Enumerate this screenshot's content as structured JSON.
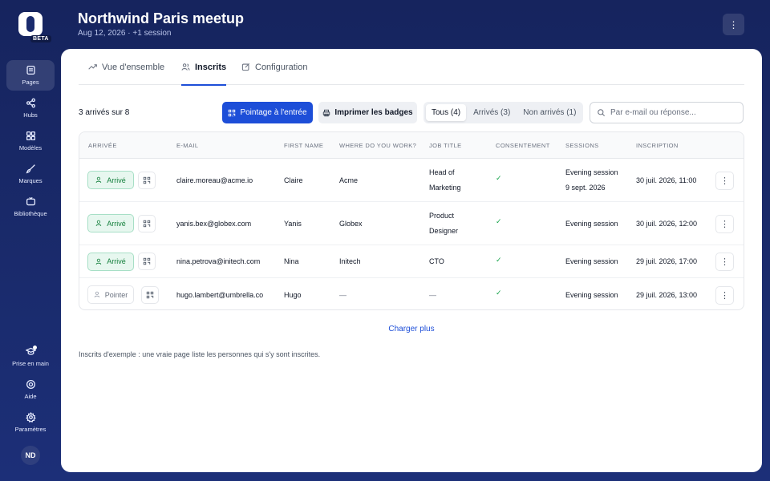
{
  "app": {
    "beta_label": "BETA"
  },
  "sidebar": {
    "items": [
      {
        "label": "Pages",
        "icon": "pages-icon"
      },
      {
        "label": "Hubs",
        "icon": "share-icon"
      },
      {
        "label": "Modèles",
        "icon": "grid-icon"
      },
      {
        "label": "Marques",
        "icon": "brush-icon"
      },
      {
        "label": "Bibliothèque",
        "icon": "tv-icon"
      }
    ],
    "bottom_items": [
      {
        "label": "Prise en main",
        "icon": "graduation-cap-icon"
      },
      {
        "label": "Aide",
        "icon": "lifebuoy-icon"
      },
      {
        "label": "Paramètres",
        "icon": "gear-icon"
      }
    ],
    "avatar_initials": "ND"
  },
  "header": {
    "title": "Northwind Paris meetup",
    "subtitle": "Aug 12, 2026 · +1 session"
  },
  "tabs": [
    {
      "label": "Vue d'ensemble",
      "icon": "trend-icon"
    },
    {
      "label": "Inscrits",
      "icon": "users-icon",
      "active": true
    },
    {
      "label": "Configuration",
      "icon": "edit-icon"
    }
  ],
  "toolbar": {
    "count_label": "3 arrivés sur 8",
    "checkin_label": "Pointage à l'entrée",
    "print_label": "Imprimer les badges",
    "filters": [
      {
        "label": "Tous",
        "count": "(4)",
        "active": true
      },
      {
        "label": "Arrivés",
        "count": "(3)"
      },
      {
        "label": "Non arrivés",
        "count": "(1)"
      }
    ],
    "search_placeholder": "Par e-mail ou réponse..."
  },
  "table": {
    "columns": [
      "ARRIVÉE",
      "E-MAIL",
      "FIRST NAME",
      "WHERE DO YOU WORK?",
      "JOB TITLE",
      "CONSENTEMENT",
      "SESSIONS",
      "INSCRIPTION"
    ],
    "rows": [
      {
        "status": "Arrivé",
        "email": "claire.moreau@acme.io",
        "first_name": "Claire",
        "work": "Acme",
        "job": [
          "Head of",
          "Marketing"
        ],
        "consent": "✓",
        "sessions": [
          "Evening session",
          "9 sept. 2026"
        ],
        "registered": "30 juil. 2026, 11:00"
      },
      {
        "status": "Arrivé",
        "email": "yanis.bex@globex.com",
        "first_name": "Yanis",
        "work": "Globex",
        "job": [
          "Product",
          "Designer"
        ],
        "consent": "✓",
        "sessions": [
          "Evening session"
        ],
        "registered": "30 juil. 2026, 12:00"
      },
      {
        "status": "Arrivé",
        "email": "nina.petrova@initech.com",
        "first_name": "Nina",
        "work": "Initech",
        "job": [
          "CTO"
        ],
        "consent": "✓",
        "sessions": [
          "Evening session"
        ],
        "registered": "29 juil. 2026, 17:00"
      },
      {
        "status": "Pointer",
        "email": "hugo.lambert@umbrella.co",
        "first_name": "Hugo",
        "work": "—",
        "job": [
          "—"
        ],
        "consent": "✓",
        "sessions": [
          "Evening session"
        ],
        "registered": "29 juil. 2026, 13:00"
      }
    ]
  },
  "load_more_label": "Charger plus",
  "footnote": "Inscrits d'exemple : une vraie page liste les personnes qui s'y sont inscrites.",
  "colors": {
    "accent": "#1d4ed8",
    "success": "#15803d",
    "background": "#1a2b6d"
  }
}
